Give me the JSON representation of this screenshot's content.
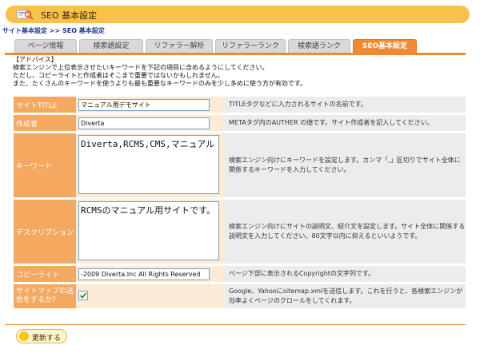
{
  "header": {
    "title": "SEO 基本設定",
    "icon": "seo-magnifier-icon"
  },
  "breadcrumb": {
    "parent": "サイト基本設定",
    "separator": " >> ",
    "current": "SEO 基本設定"
  },
  "tabs": [
    {
      "label": "ページ情報"
    },
    {
      "label": "検索語設定"
    },
    {
      "label": "リファラー解析"
    },
    {
      "label": "リファラーランク"
    },
    {
      "label": "検索語ランク"
    },
    {
      "label": "SEO基本設定"
    }
  ],
  "advice": {
    "heading": "【アドバイス】",
    "line1": "検索エンジンで上位表示させたいキーワードを下記の項目に含めるようにしてください。",
    "line2": "ただし、コピーライトと作成者はそこまで重要ではないかもしれません。",
    "line3": "また、たくさんのキーワードを使うよりも最も重要なキーワードのみを少し多めに使う方が有効です。"
  },
  "form": {
    "site_title": {
      "label": "サイトTITLE",
      "value": "マニュアル用デモサイト",
      "desc": "TITLEタグなどに入力されるサイトの名前です。"
    },
    "author": {
      "label": "作成者",
      "value": "Diverta",
      "desc": "METAタグ内のAUTHER の値です。サイト作成者を記入してください。"
    },
    "keywords": {
      "label": "キーワード",
      "value": "Diverta,RCMS,CMS,マニュアル",
      "desc": "検索エンジン向けにキーワードを設定します。カンマ「,」区切りでサイト全体に関係するキーワードを入力してください。"
    },
    "description": {
      "label": "デスクリプション",
      "value": "RCMSのマニュアル用サイトです。",
      "desc": "検索エンジン向けにサイトの説明文、紹介文を設定します。サイト全体に関係する説明文を入力してください。80文字以内に抑えるといいようです。"
    },
    "copyright": {
      "label": "コピーライト",
      "value": "-2009 Diverta.Inc All Rights Reserved",
      "desc": "ページ下部に表示されるCopyrightの文字列です。"
    },
    "sitemap": {
      "label": "サイトマップの送信をするか？",
      "checked": true,
      "desc": "Google、Yahooにsitemap.xmlを送信します。これを行うと、各検索エンジンが効率よくページのクロールをしてくれます。"
    }
  },
  "actions": {
    "update_label": "更新する"
  },
  "colors": {
    "header_bar": "#f7c14a",
    "accent": "#f08a32",
    "label_bg": "#f5a85f",
    "field_bg": "#fdebd6",
    "desc_bg": "#ececec"
  }
}
